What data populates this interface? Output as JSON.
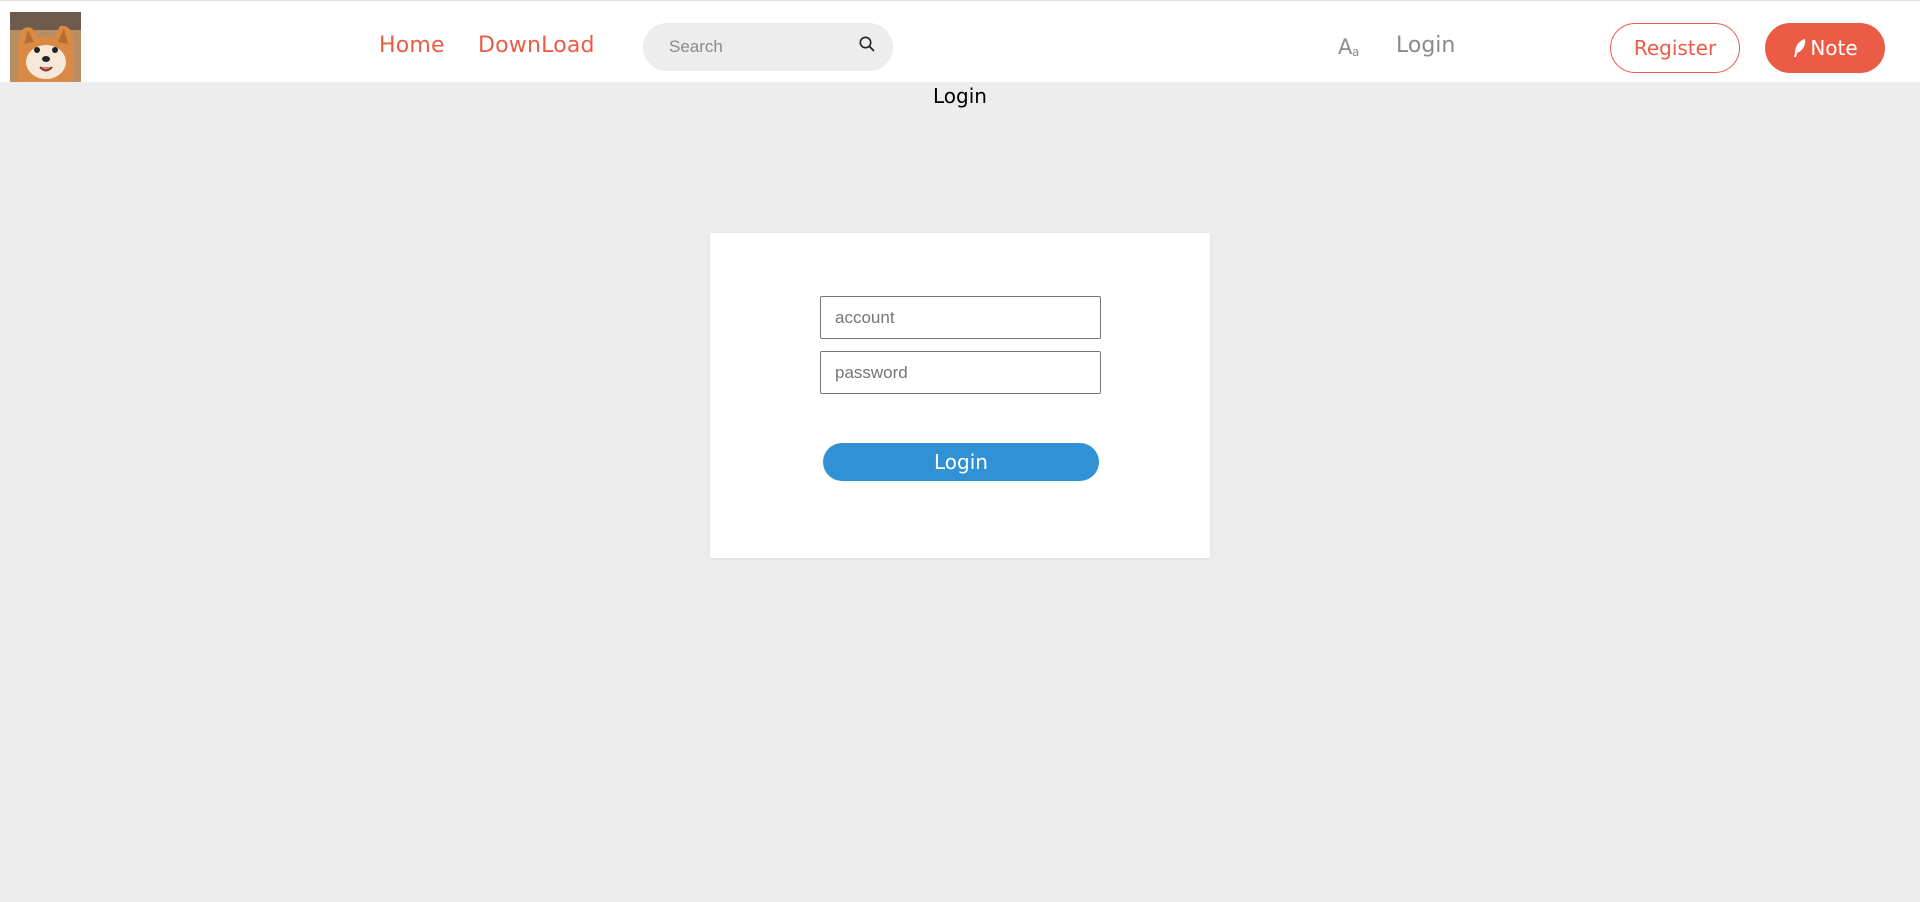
{
  "theme": {
    "accent": "#eb5b45",
    "primary_button": "#3092d4",
    "page_background": "#ededed"
  },
  "header": {
    "avatar_icon": "shiba-dog-avatar",
    "nav": [
      {
        "label": "Home"
      },
      {
        "label": "DownLoad"
      }
    ],
    "search": {
      "placeholder": "Search",
      "icon": "search-icon"
    },
    "font_size_icon": {
      "big": "A",
      "small": "a"
    },
    "login_label": "Login",
    "register_label": "Register",
    "note_label": "Note",
    "note_icon": "feather-icon"
  },
  "main": {
    "title": "Login",
    "form": {
      "account_placeholder": "account",
      "password_placeholder": "password",
      "submit_label": "Login"
    }
  }
}
